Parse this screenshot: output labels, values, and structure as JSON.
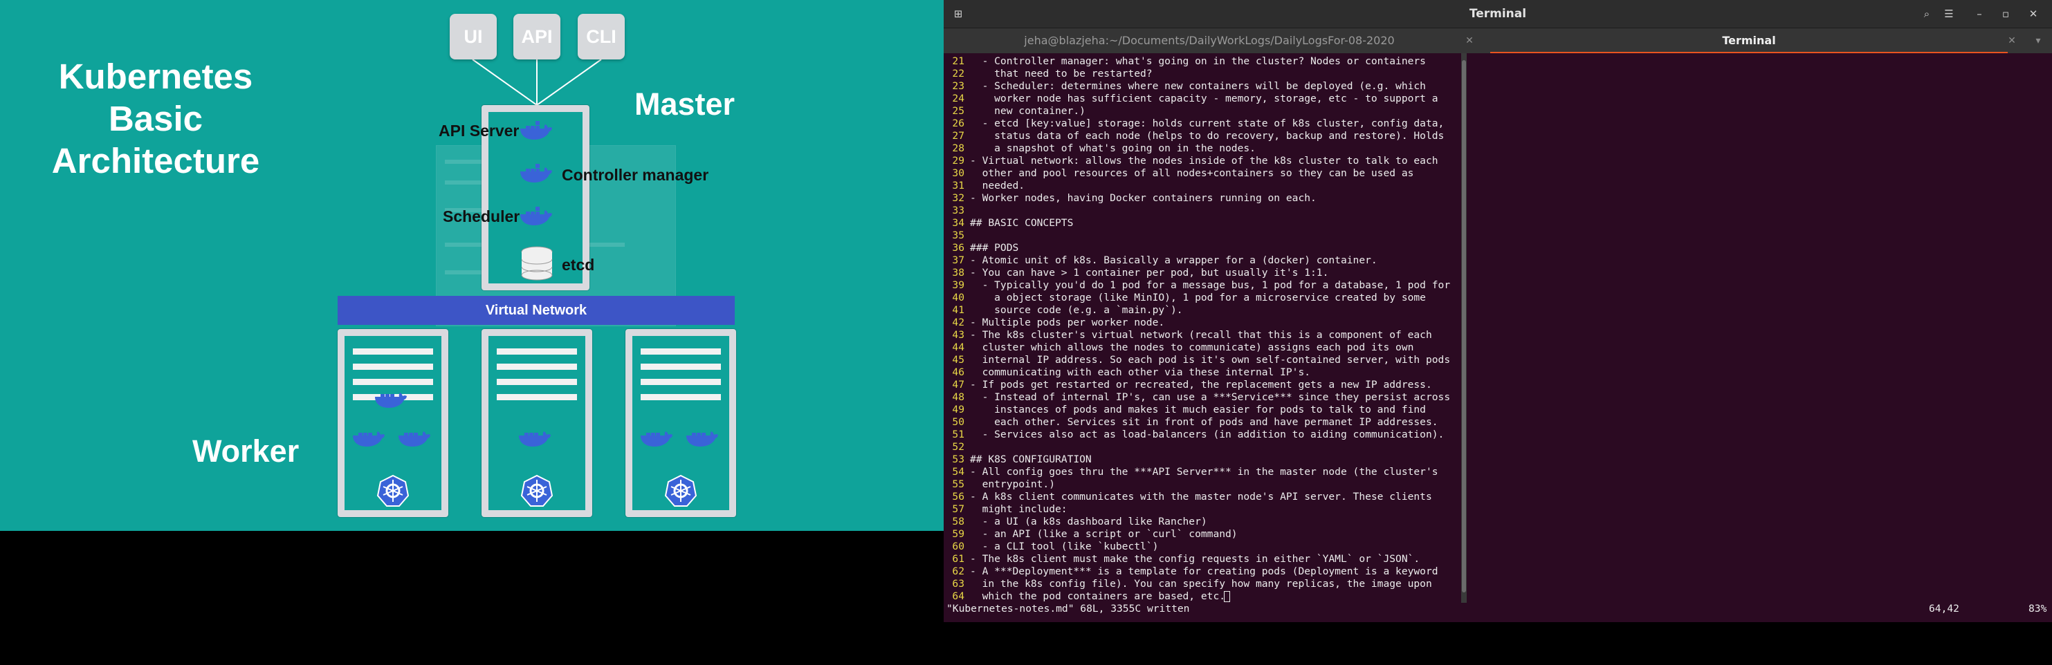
{
  "slide": {
    "title": "Kubernetes\nBasic\nArchitecture",
    "master_label": "Master",
    "worker_label": "Worker",
    "clients": [
      "UI",
      "API",
      "CLI"
    ],
    "components": {
      "api_server": "API Server",
      "controller_manager": "Controller manager",
      "scheduler": "Scheduler",
      "etcd": "etcd"
    },
    "virtual_network": "Virtual Network"
  },
  "terminal": {
    "window_title": "Terminal",
    "tabs": [
      {
        "label": "jeha@blazjeha:~/Documents/DailyWorkLogs/DailyLogsFor-08-2020"
      },
      {
        "label": "Terminal"
      }
    ],
    "lines": [
      {
        "n": "21",
        "t": "  - Controller manager: what's going on in the cluster? Nodes or containers"
      },
      {
        "n": "22",
        "t": "    that need to be restarted?"
      },
      {
        "n": "23",
        "t": "  - Scheduler: determines where new containers will be deployed (e.g. which"
      },
      {
        "n": "24",
        "t": "    worker node has sufficient capacity - memory, storage, etc - to support a"
      },
      {
        "n": "25",
        "t": "    new container.)"
      },
      {
        "n": "26",
        "t": "  - etcd [key:value] storage: holds current state of k8s cluster, config data,"
      },
      {
        "n": "27",
        "t": "    status data of each node (helps to do recovery, backup and restore). Holds"
      },
      {
        "n": "28",
        "t": "    a snapshot of what's going on in the nodes."
      },
      {
        "n": "29",
        "t": "- Virtual network: allows the nodes inside of the k8s cluster to talk to each"
      },
      {
        "n": "30",
        "t": "  other and pool resources of all nodes+containers so they can be used as"
      },
      {
        "n": "31",
        "t": "  needed."
      },
      {
        "n": "32",
        "t": "- Worker nodes, having Docker containers running on each."
      },
      {
        "n": "33",
        "t": ""
      },
      {
        "n": "34",
        "t": "## BASIC CONCEPTS"
      },
      {
        "n": "35",
        "t": ""
      },
      {
        "n": "36",
        "t": "### PODS"
      },
      {
        "n": "37",
        "t": "- Atomic unit of k8s. Basically a wrapper for a (docker) container."
      },
      {
        "n": "38",
        "t": "- You can have > 1 container per pod, but usually it's 1:1."
      },
      {
        "n": "39",
        "t": "  - Typically you'd do 1 pod for a message bus, 1 pod for a database, 1 pod for"
      },
      {
        "n": "40",
        "t": "    a object storage (like MinIO), 1 pod for a microservice created by some"
      },
      {
        "n": "41",
        "t": "    source code (e.g. a `main.py`)."
      },
      {
        "n": "42",
        "t": "- Multiple pods per worker node."
      },
      {
        "n": "43",
        "t": "- The k8s cluster's virtual network (recall that this is a component of each"
      },
      {
        "n": "44",
        "t": "  cluster which allows the nodes to communicate) assigns each pod its own"
      },
      {
        "n": "45",
        "t": "  internal IP address. So each pod is it's own self-contained server, with pods"
      },
      {
        "n": "46",
        "t": "  communicating with each other via these internal IP's."
      },
      {
        "n": "47",
        "t": "- If pods get restarted or recreated, the replacement gets a new IP address."
      },
      {
        "n": "48",
        "t": "  - Instead of internal IP's, can use a ***Service*** since they persist across"
      },
      {
        "n": "49",
        "t": "    instances of pods and makes it much easier for pods to talk to and find"
      },
      {
        "n": "50",
        "t": "    each other. Services sit in front of pods and have permanet IP addresses."
      },
      {
        "n": "51",
        "t": "  - Services also act as load-balancers (in addition to aiding communication)."
      },
      {
        "n": "52",
        "t": ""
      },
      {
        "n": "53",
        "t": "## K8S CONFIGURATION"
      },
      {
        "n": "54",
        "t": "- All config goes thru the ***API Server*** in the master node (the cluster's"
      },
      {
        "n": "55",
        "t": "  entrypoint.)"
      },
      {
        "n": "56",
        "t": "- A k8s client communicates with the master node's API server. These clients"
      },
      {
        "n": "57",
        "t": "  might include:"
      },
      {
        "n": "58",
        "t": "  - a UI (a k8s dashboard like Rancher)"
      },
      {
        "n": "59",
        "t": "  - an API (like a script or `curl` command)"
      },
      {
        "n": "60",
        "t": "  - a CLI tool (like `kubectl`)"
      },
      {
        "n": "61",
        "t": "- The k8s client must make the config requests in either `YAML` or `JSON`."
      },
      {
        "n": "62",
        "t": "- A ***Deployment*** is a template for creating pods (Deployment is a keyword"
      },
      {
        "n": "63",
        "t": "  in the k8s config file). You can specify how many replicas, the image upon"
      },
      {
        "n": "64",
        "t": "  which the pod containers are based, etc."
      }
    ],
    "status": {
      "message": "\"Kubernetes-notes.md\" 68L, 3355C written",
      "position": "64,42",
      "percent": "83%"
    }
  },
  "colors": {
    "slide_bg": "#0fa39a",
    "terminal_bg": "#2b0a22",
    "line_number": "#e9d847",
    "active_tab_underline": "#e95420",
    "virtual_network": "#3d55c6"
  }
}
